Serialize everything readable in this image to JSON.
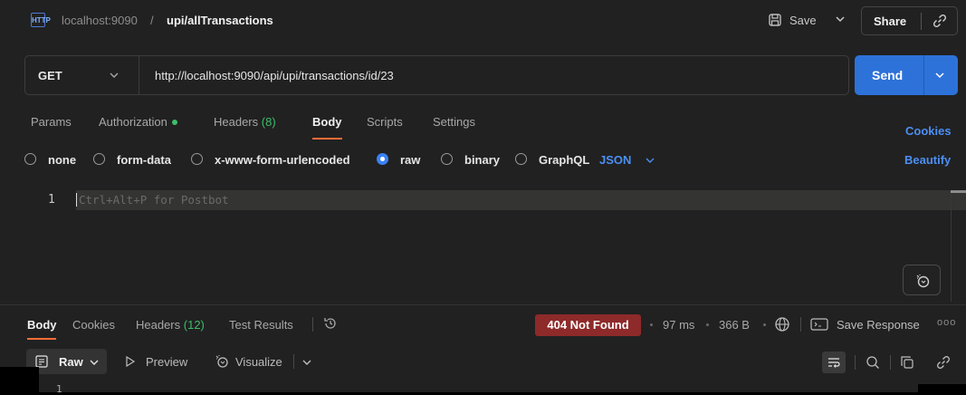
{
  "title": {
    "icon_text": "HTTP",
    "host": "localhost:9090",
    "separator": "/",
    "request_name": "upi/allTransactions",
    "save_label": "Save",
    "share_label": "Share"
  },
  "request": {
    "method": "GET",
    "url": "http://localhost:9090/api/upi/transactions/id/23",
    "send_label": "Send"
  },
  "request_tabs": {
    "params": "Params",
    "authorization": "Authorization",
    "headers": "Headers",
    "headers_count": "(8)",
    "body": "Body",
    "scripts": "Scripts",
    "settings": "Settings",
    "cookies_link": "Cookies"
  },
  "body_types": {
    "none": "none",
    "form_data": "form-data",
    "urlencoded": "x-www-form-urlencoded",
    "raw": "raw",
    "binary": "binary",
    "graphql": "GraphQL",
    "format": "JSON",
    "beautify": "Beautify"
  },
  "editor": {
    "line_number": "1",
    "placeholder": "Ctrl+Alt+P for Postbot"
  },
  "response_tabs": {
    "body": "Body",
    "cookies": "Cookies",
    "headers": "Headers",
    "headers_count": "(12)",
    "test_results": "Test Results"
  },
  "response_meta": {
    "status": "404 Not Found",
    "time": "97 ms",
    "size": "366 B",
    "save_response": "Save Response",
    "more": "ooo"
  },
  "response_toolbar": {
    "raw": "Raw",
    "preview": "Preview",
    "visualize": "Visualize",
    "line_number": "1"
  },
  "colors": {
    "accent_orange": "#ff6c37",
    "send_blue": "#2d72d9",
    "link_blue": "#4c8ff5",
    "status_red": "#8e2a2a",
    "auth_green": "#3dbd6a"
  }
}
